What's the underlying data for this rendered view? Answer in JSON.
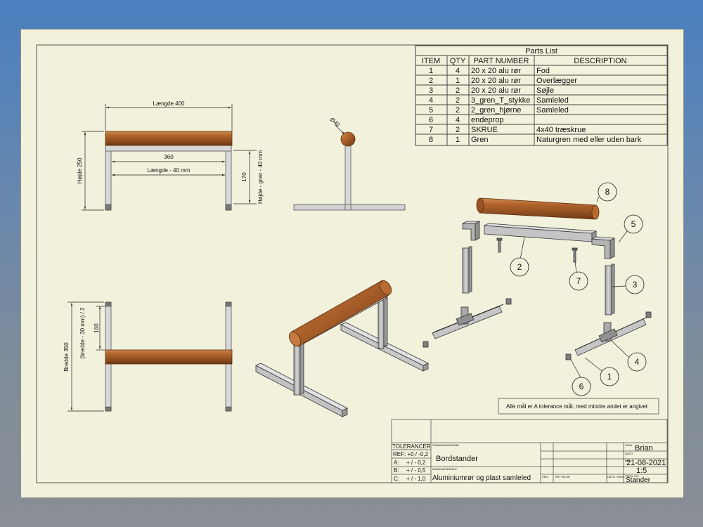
{
  "parts_list": {
    "title": "Parts List",
    "headers": [
      "ITEM",
      "QTY",
      "PART NUMBER",
      "DESCRIPTION"
    ],
    "rows": [
      [
        "1",
        "4",
        "20 x 20 alu rør",
        "Fod"
      ],
      [
        "2",
        "1",
        "20 x 20 alu rør",
        "Overlægger"
      ],
      [
        "3",
        "2",
        "20 x 20 alu rør",
        "Søjle"
      ],
      [
        "4",
        "2",
        "3_gren_T_stykke",
        "Samleled"
      ],
      [
        "5",
        "2",
        "2_gren_hjørne",
        "Samleled"
      ],
      [
        "6",
        "4",
        "endeprop",
        ""
      ],
      [
        "7",
        "2",
        "SKRUE",
        "4x40 træskrue"
      ],
      [
        "8",
        "1",
        "Gren",
        "Naturgren med eller uden bark"
      ]
    ]
  },
  "dimensions": {
    "length_400": "Længde 400",
    "d360": "360",
    "length_minus_40": "Længde - 40 mm",
    "height_250": "Højde 250",
    "d170": "170",
    "height_minus": "Højde - gren - 40 mm",
    "diameter_40": "Ø40",
    "width_350": "Bredde 350",
    "width_half": "(bredde - 30 mm) / 2",
    "d160": "160"
  },
  "balloons": [
    "1",
    "2",
    "3",
    "4",
    "5",
    "6",
    "7",
    "8"
  ],
  "note": "Alle mål er A tolerance mål,  med mindre andet er angivet",
  "title_block": {
    "tolerancer": "TOLERANCER",
    "ref": "REF: +0 / -0,2",
    "a_label": "A:",
    "a_value": "+ / - 0,2",
    "b_label": "B:",
    "b_value": "+ / - 0,5",
    "c_label": "C:",
    "c_value": "+ / - 1,0",
    "firma_label": "FIRMANAVN/MODEL:",
    "model": "Bordstander",
    "emne_label": "EMNE/MATERIALE",
    "material": "Aluminiumrør og plast samleled",
    "ver_label": "VER.",
    "rettelse_label": "RETTELSE",
    "dato_sign_label": "DATO / SIGN.",
    "sign_label": "SIGN.",
    "sign_value": "Brian",
    "dato_label": "DATO",
    "dato_value": "21-08-2021",
    "maal_label": "MÅL",
    "maal_value": "1:5",
    "tegn_label": "TEGN. NR.",
    "tegn_value": "Stander"
  },
  "colors": {
    "paper": "#f2f1dc",
    "wood": "#a0522d",
    "metal": "#bdbdbd"
  }
}
